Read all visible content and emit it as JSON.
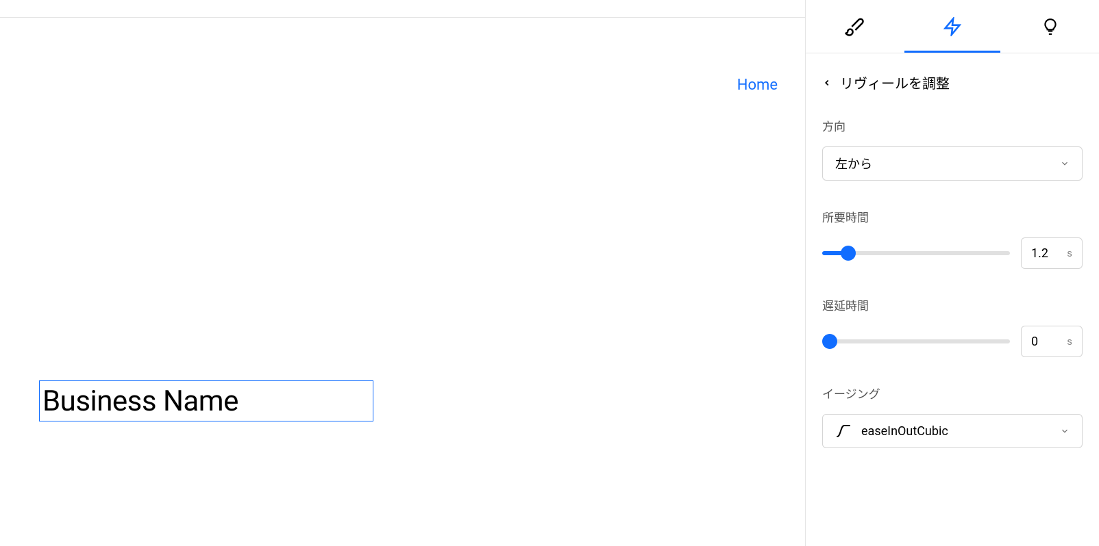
{
  "canvas": {
    "homeLink": "Home",
    "selectedText": "Business Name"
  },
  "panel": {
    "backLabel": "リヴィールを調整",
    "direction": {
      "label": "方向",
      "value": "左から"
    },
    "duration": {
      "label": "所要時間",
      "value": "1.2",
      "unit": "s",
      "sliderPercent": 14
    },
    "delay": {
      "label": "遅延時間",
      "value": "0",
      "unit": "s",
      "sliderPercent": 0
    },
    "easing": {
      "label": "イージング",
      "value": "easeInOutCubic"
    }
  }
}
